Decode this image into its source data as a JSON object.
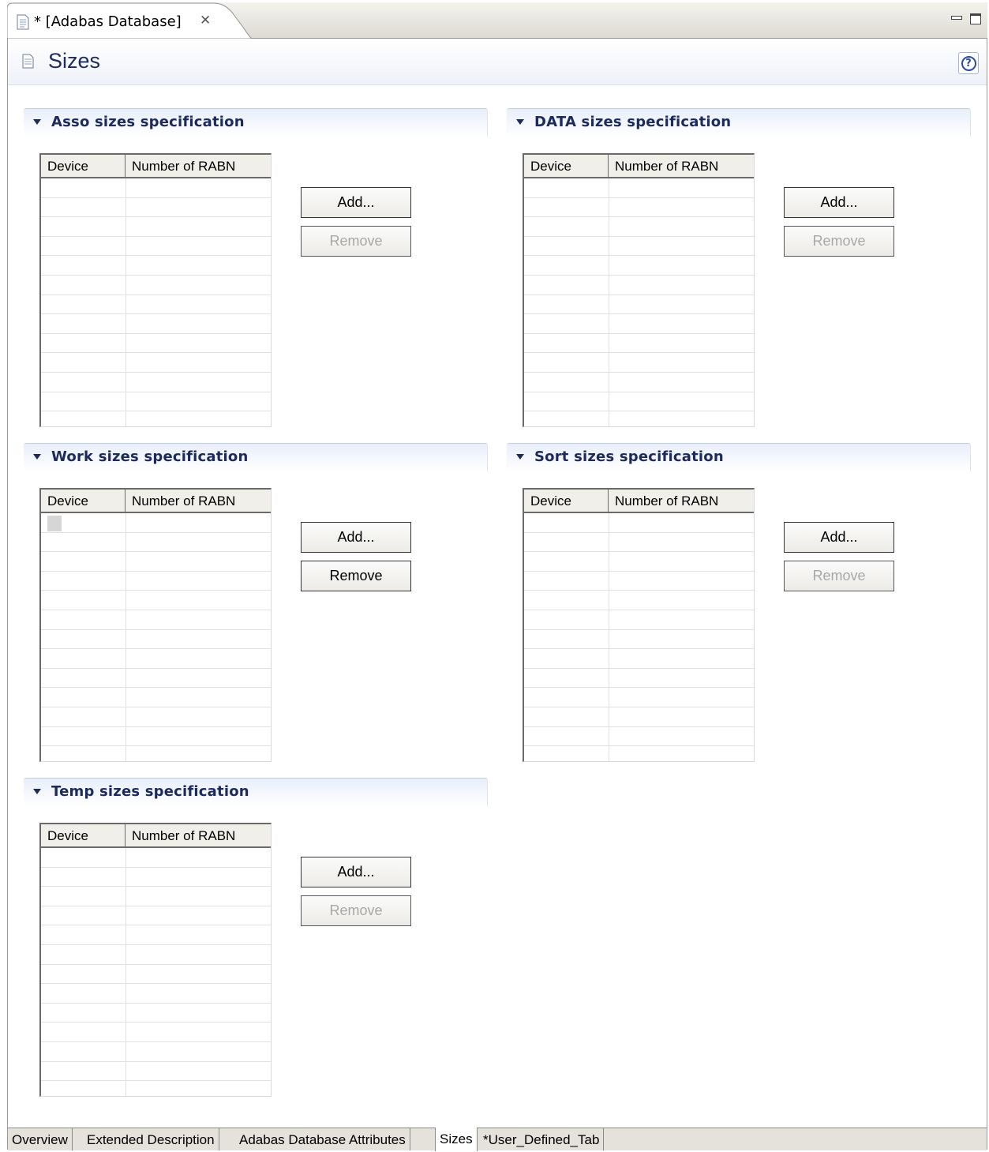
{
  "editor_tab": {
    "title": "* [Adabas Database]",
    "icon": "document-icon",
    "close_icon": "close-icon"
  },
  "window_controls": [
    "minimize-icon",
    "maximize-icon"
  ],
  "form": {
    "title": "Sizes",
    "icon": "page-icon",
    "help_icon": "help-icon"
  },
  "sections": {
    "asso": {
      "title": "Asso sizes specification",
      "columns": [
        "Device",
        "Number of RABN"
      ],
      "add_label": "Add...",
      "remove_label": "Remove",
      "remove_enabled": false
    },
    "data": {
      "title": "DATA sizes specification",
      "columns": [
        "Device",
        "Number of RABN"
      ],
      "add_label": "Add...",
      "remove_label": "Remove",
      "remove_enabled": false
    },
    "work": {
      "title": "Work sizes specification",
      "columns": [
        "Device",
        "Number of RABN"
      ],
      "add_label": "Add...",
      "remove_label": "Remove",
      "remove_enabled": true
    },
    "sort": {
      "title": "Sort sizes specification",
      "columns": [
        "Device",
        "Number of RABN"
      ],
      "add_label": "Add...",
      "remove_label": "Remove",
      "remove_enabled": false
    },
    "temp": {
      "title": "Temp sizes specification",
      "columns": [
        "Device",
        "Number of RABN"
      ],
      "add_label": "Add...",
      "remove_label": "Remove",
      "remove_enabled": false
    }
  },
  "bottom_tabs": [
    {
      "label": "Overview",
      "active": false
    },
    {
      "label": "Extended Description",
      "active": false
    },
    {
      "label": "Adabas Database Attributes",
      "active": false
    },
    {
      "label": "Sizes",
      "active": true
    },
    {
      "label": "*User_Defined_Tab",
      "active": false
    }
  ]
}
